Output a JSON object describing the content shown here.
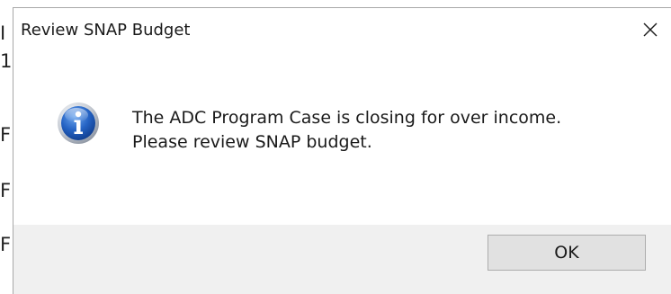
{
  "dialog": {
    "title": "Review SNAP Budget",
    "close_icon": "close-icon",
    "icon": "info-icon",
    "message_lines": [
      "The ADC Program Case is closing for over income.",
      "Please review SNAP budget."
    ],
    "ok_label": "OK"
  },
  "background": {
    "edge_glyphs": [
      "I",
      "1",
      "F",
      "F",
      "F"
    ]
  },
  "colors": {
    "footer_bg": "#f0f0f0",
    "button_bg": "#e1e1e1",
    "button_border": "#adadad",
    "icon_blue": "#1f5fb8"
  }
}
